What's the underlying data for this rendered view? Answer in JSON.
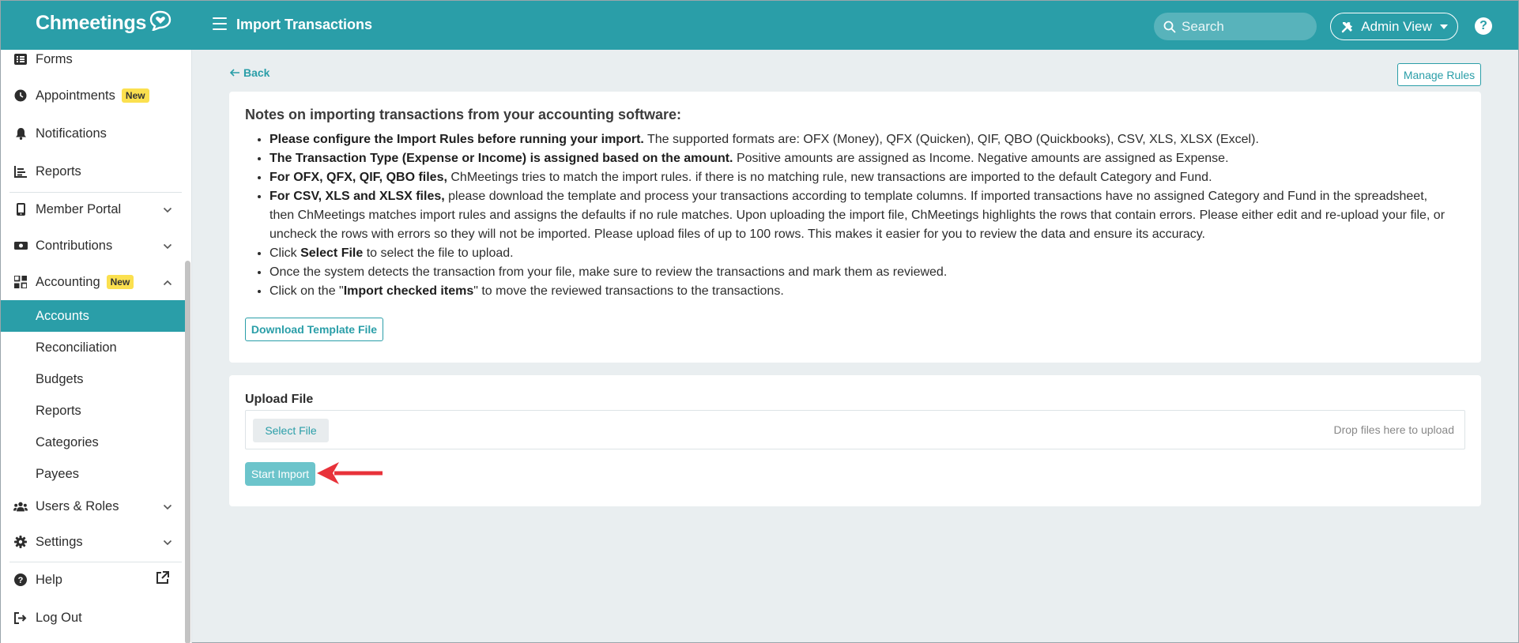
{
  "topbar": {
    "brand": "Chmeetings",
    "page_title": "Import Transactions",
    "search_placeholder": "Search",
    "admin_label": "Admin View",
    "help_symbol": "?",
    "colors": {
      "primary": "#2a9ea8"
    }
  },
  "sidebar": {
    "items": [
      {
        "label": "Forms",
        "icon": "list-icon"
      },
      {
        "label": "Appointments",
        "icon": "clock-icon",
        "badge": "New"
      },
      {
        "label": "Notifications",
        "icon": "bell-icon"
      },
      {
        "label": "Reports",
        "icon": "chart-icon"
      },
      {
        "label": "Member Portal",
        "icon": "mobile-icon"
      },
      {
        "label": "Contributions",
        "icon": "dollar-icon"
      },
      {
        "label": "Accounting",
        "icon": "grid-icon",
        "badge": "New"
      },
      {
        "label": "Users & Roles",
        "icon": "users-icon"
      },
      {
        "label": "Settings",
        "icon": "gear-icon"
      },
      {
        "label": "Help",
        "icon": "question-icon"
      },
      {
        "label": "Log Out",
        "icon": "logout-icon"
      }
    ],
    "accounting_sub": [
      "Accounts",
      "Reconciliation",
      "Budgets",
      "Reports",
      "Categories",
      "Payees"
    ],
    "active_sub": "Accounts",
    "badge_color": "#fbe04f"
  },
  "main": {
    "back_label": "Back",
    "manage_rules_label": "Manage Rules",
    "notes": {
      "title": "Notes on importing transactions from your accounting software:",
      "items": [
        {
          "bold": "Please configure the Import Rules before running your import.",
          "text": " The supported formats are: OFX (Money), QFX (Quicken), QIF, QBO (Quickbooks), CSV, XLS, XLSX (Excel)."
        },
        {
          "bold": "The Transaction Type (Expense or Income) is assigned based on the amount.",
          "text": " Positive amounts are assigned as Income. Negative amounts are assigned as Expense."
        },
        {
          "bold": "For OFX, QFX, QIF, QBO files,",
          "text": " ChMeetings tries to match the import rules. if there is no matching rule, new transactions are imported to the default Category and Fund."
        },
        {
          "bold": "For CSV, XLS and XLSX files,",
          "text": " please download the template and process your transactions according to template columns. If imported transactions have no assigned Category and Fund in the spreadsheet, then ChMeetings matches import rules and assigns the defaults if no rule matches. Upon uploading the import file, ChMeetings highlights the rows that contain errors. Please either edit and re-upload your file, or uncheck the rows with errors so they will not be imported. Please upload files of up to 100 rows. This makes it easier for you to review the data and ensure its accuracy."
        },
        {
          "pre": "Click ",
          "bold": "Select File",
          "text": " to select the file to upload."
        },
        {
          "text": "Once the system detects the transaction from your file, make sure to review the transactions and mark them as reviewed."
        },
        {
          "pre": "Click on the \"",
          "bold": "Import checked items",
          "text": "\" to move the reviewed transactions to the transactions."
        }
      ]
    },
    "download_template_label": "Download Template File",
    "upload": {
      "label": "Upload File",
      "select_label": "Select File",
      "drop_hint": "Drop files here to upload",
      "start_label": "Start Import"
    }
  }
}
